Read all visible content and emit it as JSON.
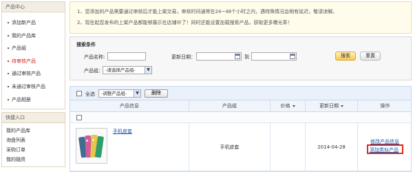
{
  "sidebar": {
    "title": "产品中心",
    "items": [
      {
        "label": "添加新产品"
      },
      {
        "label": "我的产品库"
      },
      {
        "label": "产品组"
      },
      {
        "label": "待审核产品"
      },
      {
        "label": "通过审核产品"
      },
      {
        "label": "未通过审核产品"
      },
      {
        "label": "产品相册"
      }
    ],
    "quick_title": "快捷入口",
    "quick_items": [
      {
        "label": "我的产品库"
      },
      {
        "label": "询盘列表"
      },
      {
        "label": "采购订单"
      },
      {
        "label": "我的融资"
      }
    ]
  },
  "notice": {
    "line1": "1、您添加的产品需要通过审核后才能上架交易，审核时间通常在24~48个小时之内，遇特殊情况会稍有延迟，敬请谅解。",
    "line2": "2、现在起您发布的上架产品都能够展示在店铺中了！同时还能设置加载搜索产品，获取更多曝光率！"
  },
  "search": {
    "title": "搜索条件",
    "name_label": "产品名称:",
    "name_value": "",
    "date_label": "更新日期：",
    "date_from": "",
    "date_to_label": "到",
    "date_to": "",
    "group_label": "产品组：",
    "group_select": "-请选择产品组-",
    "search_button": "搜索",
    "reset_button": "重置"
  },
  "table": {
    "select_all_label": "全选",
    "adjust_group_select": "-调整产品组-",
    "delete_button": "删除",
    "headers": {
      "info": "产品信息",
      "group": "产品组",
      "price": "价格",
      "updated": "更新日期",
      "ops": "操作"
    },
    "rows": [
      {
        "name": "手机皮套",
        "group": "手机皮套",
        "price": "",
        "updated": "2014-04-28",
        "edit_link": "修改产品信息",
        "add_similar_link": "添加类似产品"
      }
    ]
  },
  "colors": {
    "active_nav": "#d02020",
    "link": "#1b56a6",
    "highlight_box": "#e0251b",
    "search_button": "#f8c94a"
  },
  "icons": [
    "calendar-icon",
    "chevron-down-icon",
    "sort-down-icon",
    "checkbox"
  ]
}
